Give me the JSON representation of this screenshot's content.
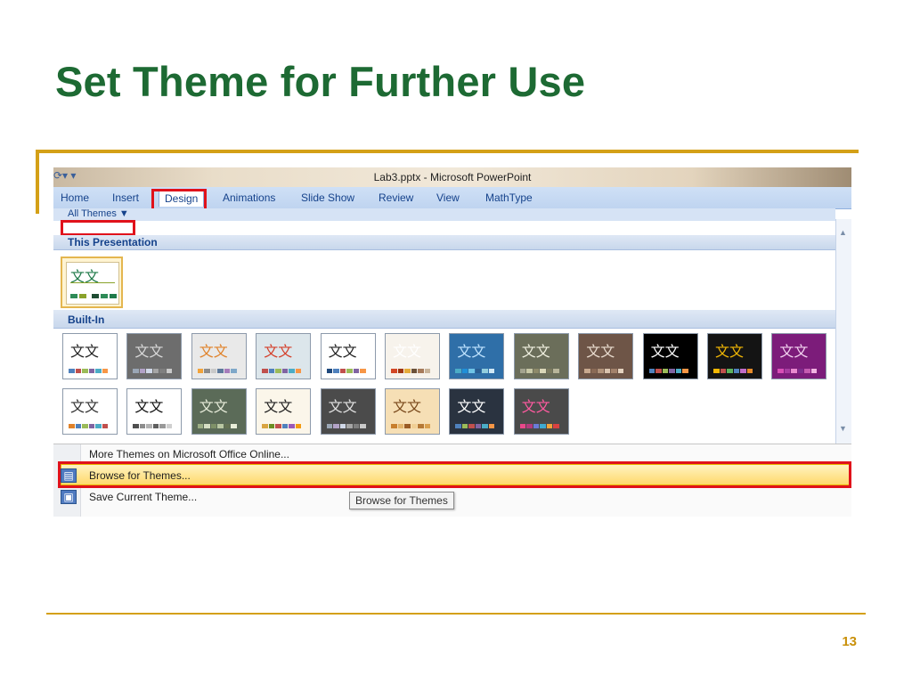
{
  "slide": {
    "title": "Set Theme for Further Use",
    "page_number": "13"
  },
  "window": {
    "title": "Lab3.pptx - Microsoft PowerPoint",
    "qat": "⟳▾ ▾"
  },
  "ribbon": {
    "tabs": [
      "Home",
      "Insert",
      "Design",
      "Animations",
      "Slide Show",
      "Review",
      "View",
      "MathType"
    ],
    "active_tab": "Design"
  },
  "gallery": {
    "filter_label": "All Themes ▼",
    "sections": {
      "this_presentation": "This Presentation",
      "built_in": "Built-In"
    },
    "current_theme_text": "文文",
    "builtin_row1": [
      {
        "text": "文文",
        "bg": "#ffffff",
        "fg": "#222222",
        "sw": [
          "#4f81bd",
          "#c0504d",
          "#9bbb59",
          "#8064a2",
          "#4bacc6",
          "#f79646"
        ]
      },
      {
        "text": "文文",
        "bg": "#6d6d6d",
        "fg": "#d9d9d9",
        "sw": [
          "#9aa6b5",
          "#b2a2c7",
          "#d0d8e8",
          "#a5a5a5",
          "#7f7f7f",
          "#c9c9c9"
        ]
      },
      {
        "text": "文文",
        "bg": "#e9e9e9",
        "fg": "#e0822a",
        "sw": [
          "#f2a33a",
          "#8d8d8d",
          "#c9c9c9",
          "#5d7a9c",
          "#a67dbb",
          "#7fa8c9"
        ]
      },
      {
        "text": "文文",
        "bg": "#dce6eb",
        "fg": "#d4402b",
        "sw": [
          "#c0504d",
          "#4f81bd",
          "#9bbb59",
          "#8064a2",
          "#4bacc6",
          "#f79646"
        ]
      },
      {
        "text": "文文",
        "bg": "#ffffff",
        "fg": "#222222",
        "sw": [
          "#1f497d",
          "#4f81bd",
          "#c0504d",
          "#9bbb59",
          "#8064a2",
          "#f79646"
        ]
      },
      {
        "text": "文文",
        "bg": "#f7f3ec",
        "fg": "#ffffff",
        "sw": [
          "#d24726",
          "#9e3611",
          "#e5ab3a",
          "#6b5139",
          "#a67b5b",
          "#c9b59b"
        ]
      },
      {
        "text": "文文",
        "bg": "#2f6fa8",
        "fg": "#bfe3ff",
        "sw": [
          "#4bacc6",
          "#1f8fd8",
          "#6fc4e6",
          "#2a5f93",
          "#93cddd",
          "#d0e8f5"
        ]
      },
      {
        "text": "文文",
        "bg": "#6b6e5a",
        "fg": "#f0f0e0",
        "sw": [
          "#a3a38f",
          "#c7c7a6",
          "#8e8a6a",
          "#dad7b8",
          "#7b7a5f",
          "#b8b59a"
        ]
      },
      {
        "text": "文文",
        "bg": "#6e5547",
        "fg": "#e9dccf",
        "sw": [
          "#c8a98f",
          "#8a6a55",
          "#b1937b",
          "#d9c3ae",
          "#a2816b",
          "#e4d2bf"
        ]
      },
      {
        "text": "文文",
        "bg": "#000000",
        "fg": "#ffffff",
        "sw": [
          "#4f81bd",
          "#c0504d",
          "#9bbb59",
          "#8064a2",
          "#4bacc6",
          "#f79646"
        ]
      },
      {
        "text": "文文",
        "bg": "#141414",
        "fg": "#f2b705",
        "sw": [
          "#f2b705",
          "#c0504d",
          "#5db35d",
          "#4f81bd",
          "#c06dc7",
          "#e48a2a"
        ]
      },
      {
        "text": "文文",
        "bg": "#7c1c7a",
        "fg": "#f3d3f0",
        "sw": [
          "#d84fb6",
          "#a63da1",
          "#e889cf",
          "#7d2d8c",
          "#c45bb1",
          "#f1b4e2"
        ]
      }
    ],
    "builtin_row2": [
      {
        "text": "文文",
        "bg": "#ffffff",
        "fg": "#333333",
        "sw": [
          "#e0822a",
          "#4f81bd",
          "#9bbb59",
          "#8064a2",
          "#4bacc6",
          "#c0504d"
        ]
      },
      {
        "text": "文文",
        "bg": "#ffffff",
        "fg": "#111111",
        "sw": [
          "#4f4f4f",
          "#8d8d8d",
          "#b2b2b2",
          "#5f5f5f",
          "#999999",
          "#cfcfcf"
        ]
      },
      {
        "text": "文文",
        "bg": "#5b6b58",
        "fg": "#e5ead8",
        "sw": [
          "#9cae85",
          "#d6dfc4",
          "#7f9168",
          "#b9c7a2",
          "#647253",
          "#e8edd9"
        ]
      },
      {
        "text": "文文",
        "bg": "#fbf6ea",
        "fg": "#222222",
        "sw": [
          "#d9a441",
          "#6b8e23",
          "#c0504d",
          "#4f81bd",
          "#9b59b6",
          "#f39c12"
        ]
      },
      {
        "text": "文文",
        "bg": "#4b4b4b",
        "fg": "#e0e0e0",
        "sw": [
          "#9aa6b5",
          "#b2a2c7",
          "#d0d8e8",
          "#a5a5a5",
          "#7f7f7f",
          "#c9c9c9"
        ]
      },
      {
        "text": "文文",
        "bg": "#f6dfb5",
        "fg": "#7a4a1c",
        "sw": [
          "#c87f2d",
          "#e2b36a",
          "#9a5b24",
          "#f0cf95",
          "#b57936",
          "#d9a04f"
        ]
      },
      {
        "text": "文文",
        "bg": "#2a3340",
        "fg": "#ffffff",
        "sw": [
          "#4f81bd",
          "#9bbb59",
          "#c0504d",
          "#8064a2",
          "#4bacc6",
          "#f79646"
        ]
      },
      {
        "text": "文文",
        "bg": "#4a4a4a",
        "fg": "#ff5aa0",
        "sw": [
          "#e8488a",
          "#b23a7d",
          "#6a7bd8",
          "#3fa9d1",
          "#f2a33a",
          "#d94141"
        ]
      }
    ]
  },
  "menu": {
    "more_themes": "More Themes on Microsoft Office Online...",
    "browse_themes": "Browse for Themes...",
    "save_theme": "Save Current Theme..."
  },
  "tooltip": "Browse for Themes",
  "colors": {
    "title_green": "#1d6a33",
    "accent_gold": "#d4a017",
    "highlight_red": "#e0121b"
  }
}
